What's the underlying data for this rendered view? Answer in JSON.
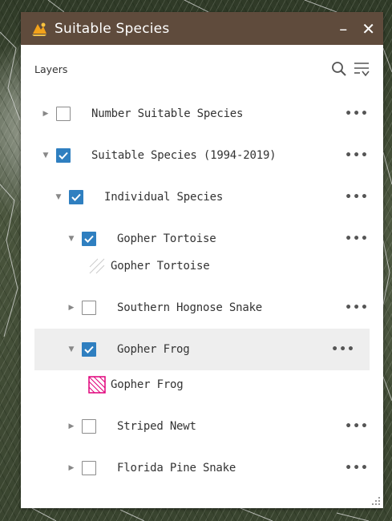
{
  "panel": {
    "title": "Suitable Species",
    "minimize": "–",
    "close": "✕",
    "layers_label": "Layers"
  },
  "layers": [
    {
      "label": "Number Suitable Species",
      "checked": false,
      "expanded": false,
      "more": "•••"
    },
    {
      "label": "Suitable Species (1994-2019)",
      "checked": true,
      "expanded": true,
      "more": "•••"
    },
    {
      "label": "Individual Species",
      "checked": true,
      "expanded": true,
      "more": "•••"
    },
    {
      "label": "Gopher Tortoise",
      "checked": true,
      "expanded": true,
      "more": "•••",
      "legend": "Gopher Tortoise"
    },
    {
      "label": "Southern Hognose Snake",
      "checked": false,
      "expanded": false,
      "more": "•••"
    },
    {
      "label": "Gopher Frog",
      "checked": true,
      "expanded": true,
      "more": "•••",
      "legend": "Gopher Frog",
      "highlighted": true
    },
    {
      "label": "Striped Newt",
      "checked": false,
      "expanded": false,
      "more": "•••"
    },
    {
      "label": "Florida Pine Snake",
      "checked": false,
      "expanded": false,
      "more": "•••"
    }
  ],
  "colors": {
    "titlebar": "#5f4b3c",
    "checkbox_checked": "#2f7fc0",
    "gopher_frog_legend": "#e0007a",
    "gopher_tortoise_legend": "#cccccc"
  }
}
